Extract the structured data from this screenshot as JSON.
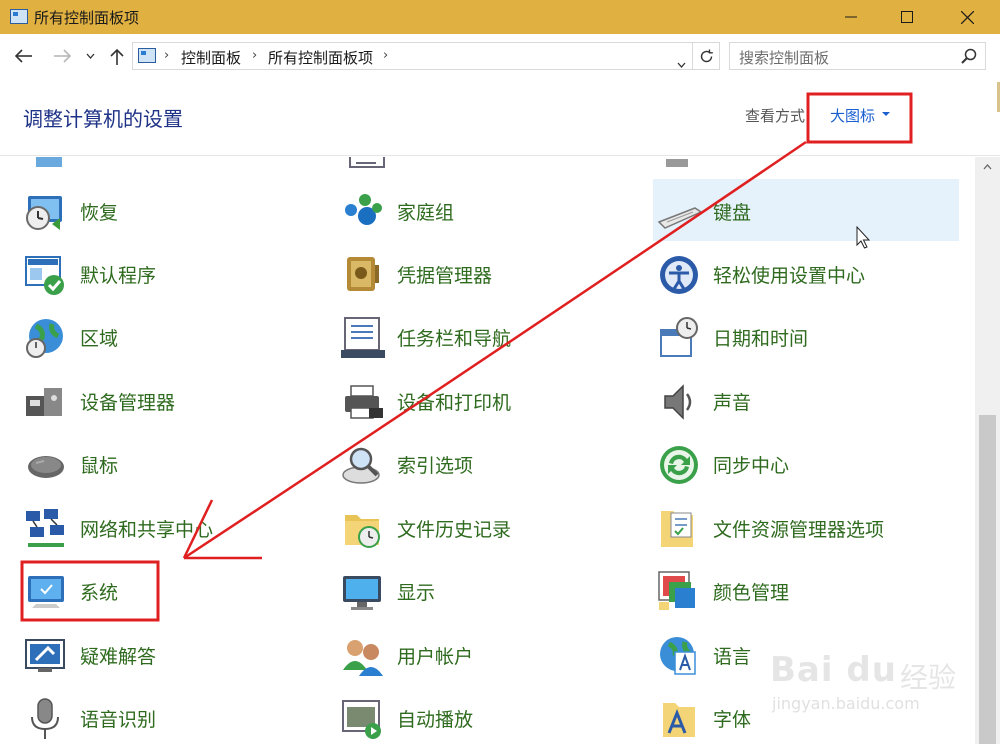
{
  "window": {
    "title": "所有控制面板项",
    "minimize_icon": "minimize-icon",
    "maximize_icon": "maximize-icon",
    "close_icon": "close-icon",
    "titlebar_color": "#e0b040"
  },
  "address_bar": {
    "breadcrumbs": [
      "控制面板",
      "所有控制面板项"
    ],
    "search_placeholder": "搜索控制面板"
  },
  "header": {
    "title": "调整计算机的设置",
    "view_by_label": "查看方式:",
    "view_by_value": "大图标"
  },
  "items": [
    {
      "label": "恢复",
      "icon": "recovery-icon"
    },
    {
      "label": "家庭组",
      "icon": "homegroup-icon"
    },
    {
      "label": "键盘",
      "icon": "keyboard-icon"
    },
    {
      "label": "默认程序",
      "icon": "default-programs-icon"
    },
    {
      "label": "凭据管理器",
      "icon": "credential-manager-icon"
    },
    {
      "label": "轻松使用设置中心",
      "icon": "ease-of-access-icon"
    },
    {
      "label": "区域",
      "icon": "region-icon"
    },
    {
      "label": "任务栏和导航",
      "icon": "taskbar-icon"
    },
    {
      "label": "日期和时间",
      "icon": "date-time-icon"
    },
    {
      "label": "设备管理器",
      "icon": "device-manager-icon"
    },
    {
      "label": "设备和打印机",
      "icon": "devices-printers-icon"
    },
    {
      "label": "声音",
      "icon": "sound-icon"
    },
    {
      "label": "鼠标",
      "icon": "mouse-icon"
    },
    {
      "label": "索引选项",
      "icon": "indexing-options-icon"
    },
    {
      "label": "同步中心",
      "icon": "sync-center-icon"
    },
    {
      "label": "网络和共享中心",
      "icon": "network-sharing-icon"
    },
    {
      "label": "文件历史记录",
      "icon": "file-history-icon"
    },
    {
      "label": "文件资源管理器选项",
      "icon": "file-explorer-options-icon"
    },
    {
      "label": "系统",
      "icon": "system-icon"
    },
    {
      "label": "显示",
      "icon": "display-icon"
    },
    {
      "label": "颜色管理",
      "icon": "color-management-icon"
    },
    {
      "label": "疑难解答",
      "icon": "troubleshooting-icon"
    },
    {
      "label": "用户帐户",
      "icon": "user-accounts-icon"
    },
    {
      "label": "语言",
      "icon": "language-icon"
    },
    {
      "label": "语音识别",
      "icon": "speech-recognition-icon"
    },
    {
      "label": "自动播放",
      "icon": "autoplay-icon"
    },
    {
      "label": "字体",
      "icon": "fonts-icon"
    }
  ],
  "watermark": {
    "brand": "Bai du",
    "brand_cn": "经验",
    "url": "jingyan.baidu.com"
  },
  "colors": {
    "item_label": "#2f6b1f",
    "title": "#1e3287",
    "link": "#1a5fd0",
    "annotation": "#e02020",
    "hover_bg": "#e5f1fb"
  }
}
